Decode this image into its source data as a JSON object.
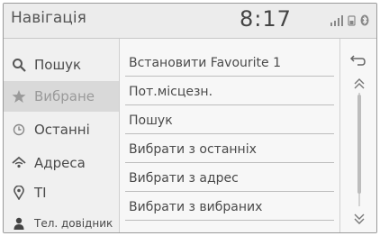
{
  "header": {
    "title": "Навігація",
    "clock": "8:17"
  },
  "sidebar": {
    "items": [
      {
        "label": "Пошук",
        "icon": "search-icon"
      },
      {
        "label": "Вибране",
        "icon": "star-icon",
        "active": true
      },
      {
        "label": "Останні",
        "icon": "clock-icon"
      },
      {
        "label": "Адреса",
        "icon": "address-icon"
      },
      {
        "label": "TI",
        "icon": "poi-pin-icon"
      },
      {
        "label": "Тел. довідник",
        "icon": "person-icon"
      }
    ]
  },
  "main": {
    "items": [
      {
        "label": "Встановити Favourite 1"
      },
      {
        "label": "Пот.місцезн."
      },
      {
        "label": "Пошук"
      },
      {
        "label": "Вибрати з останніх"
      },
      {
        "label": "Вибрати з адрес"
      },
      {
        "label": "Вибрати з вибраних"
      }
    ]
  },
  "colors": {
    "active_bg": "#d9d9d9",
    "text": "#4a4a4a",
    "divider": "#bdbdbd"
  }
}
